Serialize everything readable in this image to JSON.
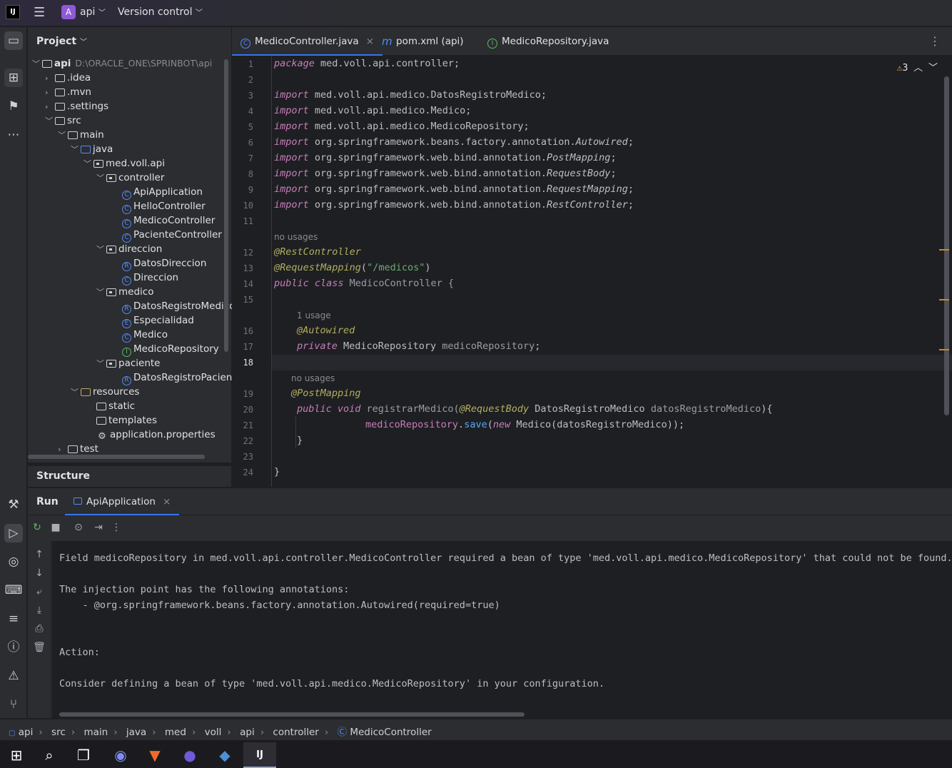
{
  "titlebar": {
    "app_logo": "IJ",
    "project_badge": "A",
    "project_name": "api",
    "vcs_label": "Version control"
  },
  "project_panel": {
    "title": "Project",
    "root_name": "api",
    "root_path": "D:\\ORACLE_ONE\\SPRINBOT\\api",
    "items": [
      {
        "label": ".idea"
      },
      {
        "label": ".mvn"
      },
      {
        "label": ".settings"
      },
      {
        "label": "src"
      },
      {
        "label": "main"
      },
      {
        "label": "java"
      },
      {
        "label": "med.voll.api"
      },
      {
        "label": "controller"
      },
      {
        "label": "ApiApplication"
      },
      {
        "label": "HelloController"
      },
      {
        "label": "MedicoController"
      },
      {
        "label": "PacienteController"
      },
      {
        "label": "direccion"
      },
      {
        "label": "DatosDireccion"
      },
      {
        "label": "Direccion"
      },
      {
        "label": "medico"
      },
      {
        "label": "DatosRegistroMedico"
      },
      {
        "label": "Especialidad"
      },
      {
        "label": "Medico"
      },
      {
        "label": "MedicoRepository"
      },
      {
        "label": "paciente"
      },
      {
        "label": "DatosRegistroPaciente"
      },
      {
        "label": "resources"
      },
      {
        "label": "static"
      },
      {
        "label": "templates"
      },
      {
        "label": "application.properties"
      },
      {
        "label": "test"
      }
    ]
  },
  "structure_panel": {
    "title": "Structure"
  },
  "editor": {
    "tabs": [
      {
        "label": "MedicoController.java",
        "icon": "C"
      },
      {
        "label": "pom.xml (api)",
        "icon": "m"
      },
      {
        "label": "MedicoRepository.java",
        "icon": "I"
      }
    ],
    "warning_count": "3",
    "line_numbers": [
      "1",
      "2",
      "3",
      "4",
      "5",
      "6",
      "7",
      "8",
      "9",
      "10",
      "11",
      "12",
      "13",
      "14",
      "15",
      "16",
      "17",
      "18",
      "19",
      "20",
      "21",
      "22",
      "23",
      "24"
    ],
    "hints": {
      "no_usages_1": "no usages",
      "usage_1": "1 usage",
      "no_usages_2": "no usages"
    },
    "code": {
      "l1_kw": "package",
      "l1_rest": " med.voll.api.controller;",
      "import_kw": "import",
      "l3": " med.voll.api.medico.DatosRegistroMedico;",
      "l4": " med.voll.api.medico.Medico;",
      "l5": " med.voll.api.medico.MedicoRepository;",
      "l6_pre": " org.springframework.beans.factory.annotation.",
      "l6_it": "Autowired",
      "l7_pre": " org.springframework.web.bind.annotation.",
      "l7_it": "PostMapping",
      "l8_pre": " org.springframework.web.bind.annotation.",
      "l8_it": "RequestBody",
      "l9_pre": " org.springframework.web.bind.annotation.",
      "l9_it": "RequestMapping",
      "l10_pre": " org.springframework.web.bind.annotation.",
      "l10_it": "RestController",
      "semi": ";",
      "l12": "@RestController",
      "l13_ann": "@RequestMapping",
      "l13_open": "(",
      "l13_str": "\"/medicos\"",
      "l13_close": ")",
      "l14_kw": "public class",
      "l14_name": " MedicoController {",
      "l16": "@Autowired",
      "l17_kw": "private",
      "l17_type": " MedicoRepository ",
      "l17_field": "medicoRepository",
      "l17_end": ";",
      "l19": "@PostMapping",
      "l20_kw": "public void",
      "l20_meth": " registrarMedico(",
      "l20_ann": "@RequestBody",
      "l20_type": " DatosRegistroMedico ",
      "l20_param": "datosRegistroMedico",
      "l20_end": "){",
      "l21_field": "medicoRepository",
      "l21_dot": ".",
      "l21_meth": "save",
      "l21_open": "(",
      "l21_new": "new",
      "l21_rest": " Medico(",
      "l21_param": "datosRegistroMedico",
      "l21_end": "));",
      "l22": "}",
      "l24": "}"
    }
  },
  "run_panel": {
    "title": "Run",
    "tab_label": "ApiApplication",
    "console_lines": [
      "Field medicoRepository in med.voll.api.controller.MedicoController required a bean of type 'med.voll.api.medico.MedicoRepository' that could not be found.",
      "The injection point has the following annotations:",
      "    - @org.springframework.beans.factory.annotation.Autowired(required=true)",
      "Action:",
      "Consider defining a bean of type 'med.voll.api.medico.MedicoRepository' in your configuration."
    ]
  },
  "breadcrumb": [
    "api",
    "src",
    "main",
    "java",
    "med",
    "voll",
    "api",
    "controller",
    "MedicoController"
  ],
  "colors": {
    "accent": "#3574f0",
    "warning": "#f0a732",
    "bg_editor": "#1e1f22",
    "bg_panel": "#2b2d30"
  }
}
